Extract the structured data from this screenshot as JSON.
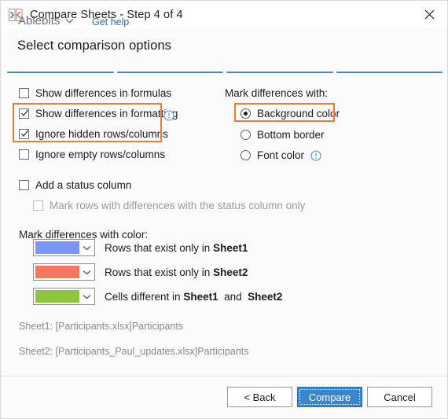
{
  "window": {
    "title": "Compare Sheets - Step 4 of 4",
    "app_icon": "compare-sheets-icon",
    "close_icon": "close-icon"
  },
  "header": {
    "step_title": "Select comparison options",
    "progress_segments": 4,
    "progress_completed": 4,
    "progress_color": "#4a86bd"
  },
  "options": {
    "left": [
      {
        "label": "Show differences in formulas",
        "checked": false,
        "disabled": false,
        "info": false
      },
      {
        "label": "Show differences in formatting",
        "checked": true,
        "disabled": false,
        "info": true
      },
      {
        "label": "Ignore hidden rows/columns",
        "checked": true,
        "disabled": false,
        "info": false
      },
      {
        "label": "Ignore empty rows/columns",
        "checked": false,
        "disabled": false,
        "info": false
      }
    ],
    "status": [
      {
        "label": "Add a status column",
        "checked": false,
        "disabled": false
      },
      {
        "label": "Mark rows with differences with the status column only",
        "checked": false,
        "disabled": true
      }
    ],
    "mark_with": {
      "title": "Mark differences with:",
      "items": [
        {
          "label": "Background color",
          "selected": true,
          "info": false
        },
        {
          "label": "Bottom border",
          "selected": false,
          "info": false
        },
        {
          "label": "Font color",
          "selected": false,
          "info": true
        }
      ]
    }
  },
  "highlight_color": "#f4782f",
  "colors_section": {
    "title": "Mark differences with color:",
    "rows": [
      {
        "swatch": "#7b96f7",
        "desc_prefix": "Rows that exist only in ",
        "desc_bold1": "Sheet1",
        "desc_mid": "",
        "desc_bold2": ""
      },
      {
        "swatch": "#f2785f",
        "desc_prefix": "Rows that exist only in ",
        "desc_bold1": "Sheet2",
        "desc_mid": "",
        "desc_bold2": ""
      },
      {
        "swatch": "#8cc63f",
        "desc_prefix": "Cells different in ",
        "desc_bold1": "Sheet1",
        "desc_mid": "  and  ",
        "desc_bold2": "Sheet2"
      }
    ]
  },
  "sheets": {
    "sheet1": "Sheet1: [Participants.xlsx]Participants",
    "sheet2": "Sheet2: [Participants_Paul_updates.xlsx]Participants"
  },
  "footer": {
    "brand": "Ablebits",
    "get_help": "Get help",
    "back": "< Back",
    "compare": "Compare",
    "cancel": "Cancel",
    "primary_color": "#3a86c8",
    "link_color": "#2b6cb0"
  }
}
